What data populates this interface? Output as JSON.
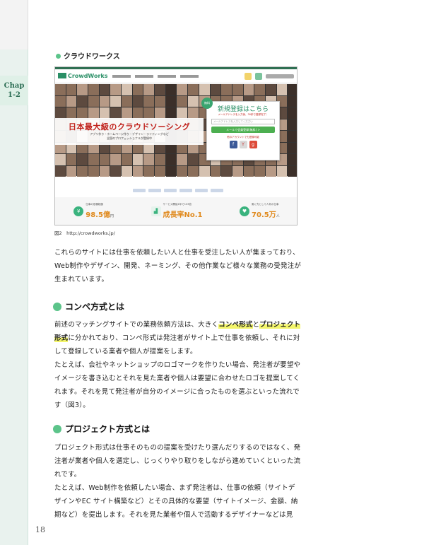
{
  "page": {
    "chapter_label_line1": "Chap",
    "chapter_label_line2": "1-2",
    "page_number": "18"
  },
  "figure": {
    "heading": "クラウドワークス",
    "caption": "図2　http://crowdworks.jp/",
    "screenshot": {
      "logo": "CrowdWorks",
      "banner_title": "日本最大級のクラウドソーシング",
      "banner_sub_line1": "アプリ作り・ホームページ作り・デザイン・ライティングなど",
      "banner_sub_line2": "全国のプロフェッショナルが登録中",
      "signup_badge": "無料",
      "signup_title": "新規登録はこちら",
      "signup_note": "メールアドレスを入力後、30秒で登録完了！",
      "signup_placeholder": "メールアドレスを入力してください",
      "signup_button": "メールで会員登録(無料) >",
      "signup_social": "他のアカウントでも登録可能",
      "stats": [
        {
          "label": "仕事の依頼総額",
          "value": "98.5億",
          "unit": "円",
          "icon": "yen-icon"
        },
        {
          "label": "サービス開始1年で103倍",
          "value": "成長率No.1",
          "unit": "",
          "icon": "chart-icon"
        },
        {
          "label": "働く先として人気の仕事",
          "value": "70.5万",
          "unit": "人",
          "icon": "heart-icon"
        }
      ]
    }
  },
  "sections": {
    "intro": "これらのサイトには仕事を依頼したい人と仕事を受注したい人が集まっており、Web制作やデザイン、開発、ネーミング、その他作業など様々な業務の受発注が生まれています。",
    "compe": {
      "heading": "コンペ方式とは",
      "p1_before": "前述のマッチングサイトでの業務依頼方法は、大きく",
      "p1_hl1": "コンペ形式",
      "p1_mid": "と",
      "p1_hl2": "プロジェクト形式",
      "p1_after": "に分かれており、コンペ形式は発注者がサイト上で仕事を依頼し、それに対して登録している業者や個人が提案をします。",
      "p2": "たとえば、会社やネットショップのロゴマークを作りたい場合、発注者が要望やイメージを書き込むとそれを見た業者や個人は要望に合わせたロゴを提案してくれます。それを見て発注者が自分のイメージに合ったものを選ぶといった流れです（図3）。"
    },
    "project": {
      "heading": "プロジェクト方式とは",
      "p1": "プロジェクト形式は仕事そのものの提案を受けたり選んだりするのではなく、発注者が業者や個人を選定し、じっくりやり取りをしながら進めていくといった流れです。",
      "p2": "たとえば、Web制作を依頼したい場合、まず発注者は、仕事の依頼（サイトデザインやEC サイト構築など）とその具体的な要望（サイトイメージ、金額、納期など）を提出します。それを見た業者や個人で活動するデザイナーなどは見"
    }
  },
  "colors": {
    "accent_green": "#5cc48a",
    "highlight_yellow": "#f3f56a",
    "band_green": "#e9f2ee"
  }
}
